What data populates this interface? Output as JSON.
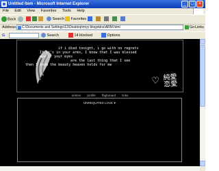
{
  "window": {
    "title": "Untitled Item - Microsoft Internet Explorer",
    "minimize": "_",
    "maximize": "□",
    "close": "×"
  },
  "menu": [
    "File",
    "Edit",
    "View",
    "Favorites",
    "Tools",
    "Help"
  ],
  "toolbar": {
    "back": "Back",
    "search": "Search",
    "favorites": "Favorites"
  },
  "address": {
    "label": "Address",
    "url": "C:\\Documents and Settings\\12\\Desktop\\myy blogskins\\ARM.html",
    "go": "Go",
    "links": "Links"
  },
  "searchbar": {
    "brand": "G",
    "search_label": "Search",
    "blocked": "14 blocked",
    "options": "Options"
  },
  "banner": {
    "lines": [
      "if i died tonight, i go with no regrets",
      "If it's in your arms, I know that I was blessed",
      "and if your eyes",
      "are the last thing that I see",
      "then I know the beauty heaven holds for me"
    ],
    "kanji": "純愛\n恋愛",
    "heart": "♡"
  },
  "nav": [
    "entries",
    "profile",
    "fbgbooard",
    "links"
  ],
  "content": {
    "label": "UNREQUITED LOVE ♥"
  },
  "colors": {
    "titlebar": "#0a3fb8",
    "chrome": "#ece9d8",
    "page_bg": "#000000",
    "text": "#ffffff"
  }
}
